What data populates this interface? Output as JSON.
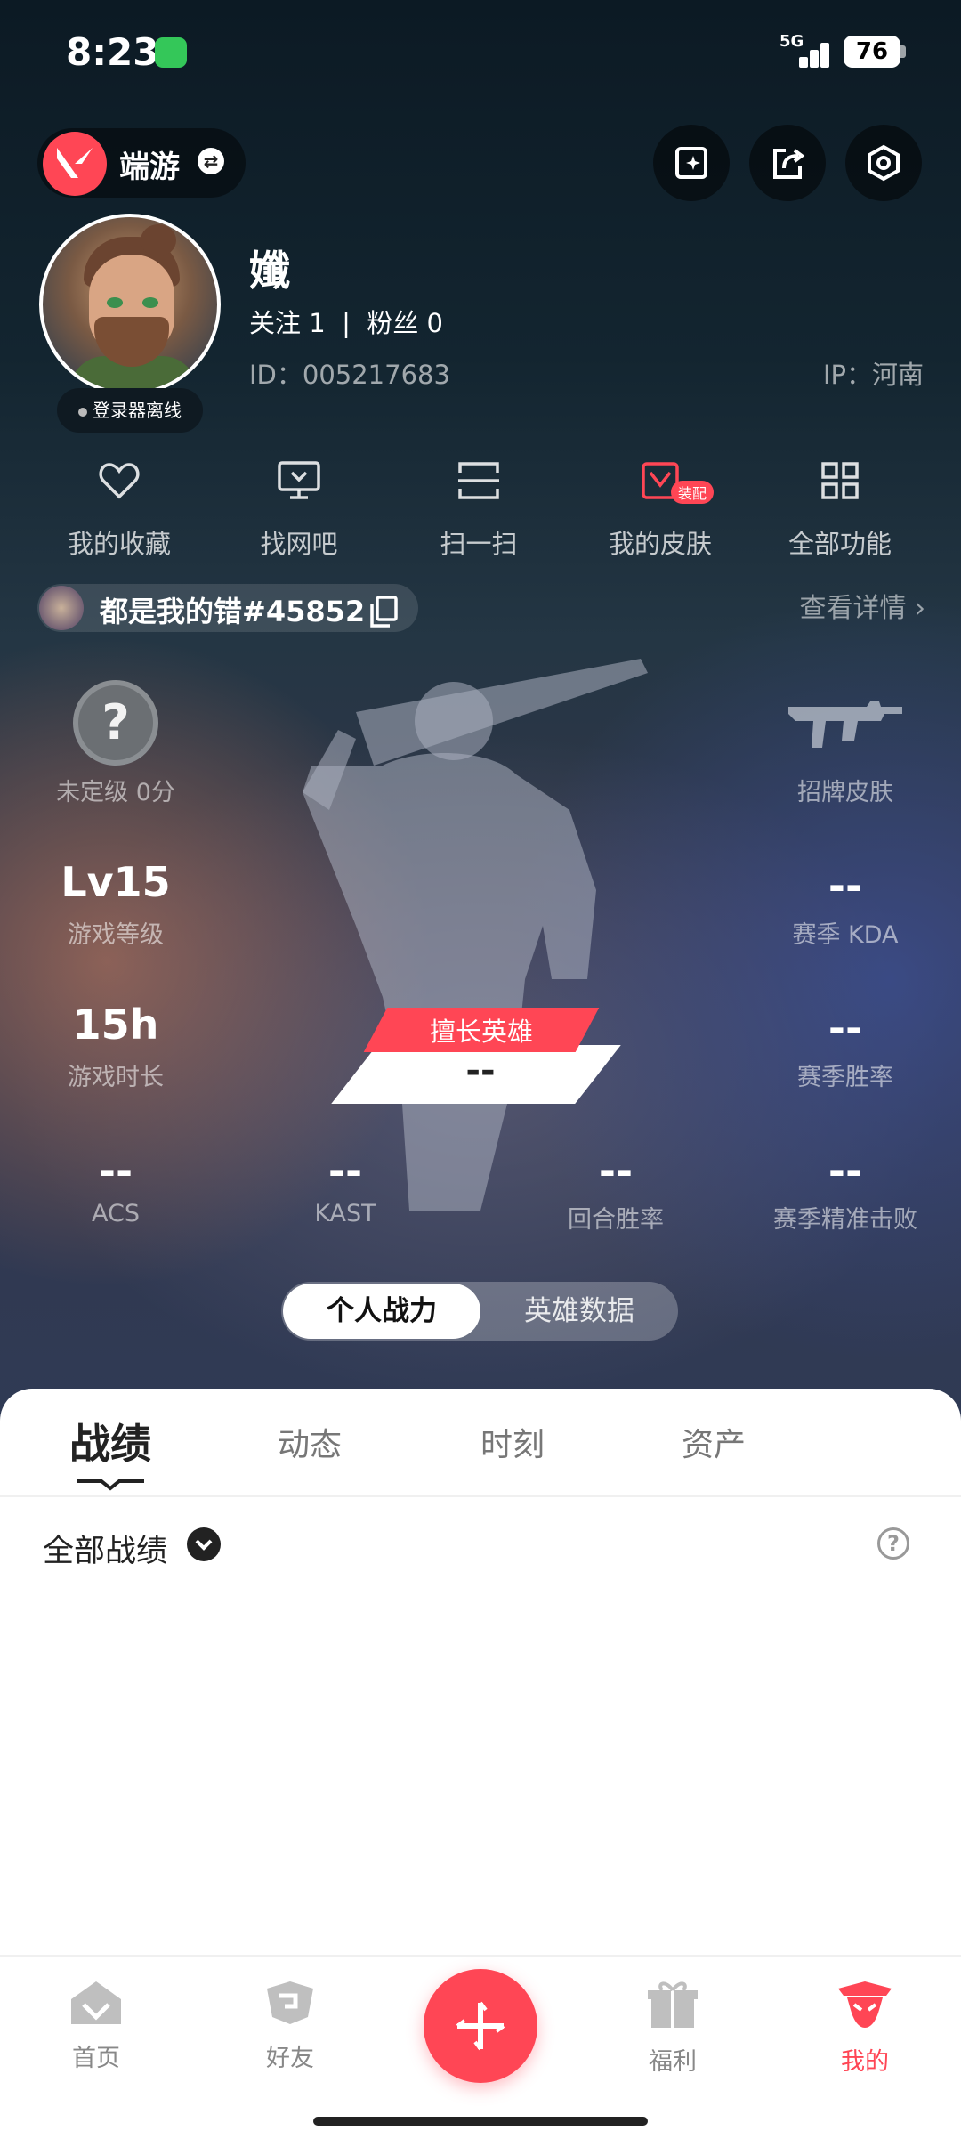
{
  "status": {
    "time": "8:23",
    "network": "5G",
    "battery": "76"
  },
  "header": {
    "mode_label": "端游"
  },
  "profile": {
    "username": "孅",
    "follow_text": "关注 1  |  粉丝 0",
    "id_text": "ID：005217683",
    "ip_text": "IP：河南",
    "offline_label": "登录器离线"
  },
  "quick_actions": [
    {
      "label": "我的收藏",
      "icon": "heart-icon"
    },
    {
      "label": "找网吧",
      "icon": "monitor-icon"
    },
    {
      "label": "扫一扫",
      "icon": "scan-icon"
    },
    {
      "label": "我的皮肤",
      "icon": "skin-icon",
      "badge": "装配"
    },
    {
      "label": "全部功能",
      "icon": "grid-icon"
    }
  ],
  "riot": {
    "name": "都是我的错#45852",
    "view_detail": "查看详情 ›"
  },
  "stats": {
    "rank_symbol": "?",
    "rank_label": "未定级 0分",
    "skin_label": "招牌皮肤",
    "level_value": "Lv15",
    "level_label": "游戏等级",
    "kda_value": "--",
    "kda_label": "赛季 KDA",
    "time_value": "15h",
    "time_label": "游戏时长",
    "winrate_value": "--",
    "winrate_label": "赛季胜率",
    "best_hero_tag": "擅长英雄",
    "best_hero_value": "--",
    "bottom": [
      {
        "value": "--",
        "label": "ACS"
      },
      {
        "value": "--",
        "label": "KAST"
      },
      {
        "value": "--",
        "label": "回合胜率"
      },
      {
        "value": "--",
        "label": "赛季精准击败"
      }
    ]
  },
  "toggle": {
    "active": "个人战力",
    "inactive": "英雄数据"
  },
  "content_tabs": [
    "战绩",
    "动态",
    "时刻",
    "资产"
  ],
  "filter": {
    "label": "全部战绩",
    "help": "?"
  },
  "bottom_nav": [
    {
      "label": "首页",
      "icon": "home-icon"
    },
    {
      "label": "好友",
      "icon": "friends-icon"
    },
    {
      "label": "福利",
      "icon": "gift-icon"
    },
    {
      "label": "我的",
      "icon": "profile-icon"
    }
  ],
  "colors": {
    "accent": "#ff4655"
  }
}
